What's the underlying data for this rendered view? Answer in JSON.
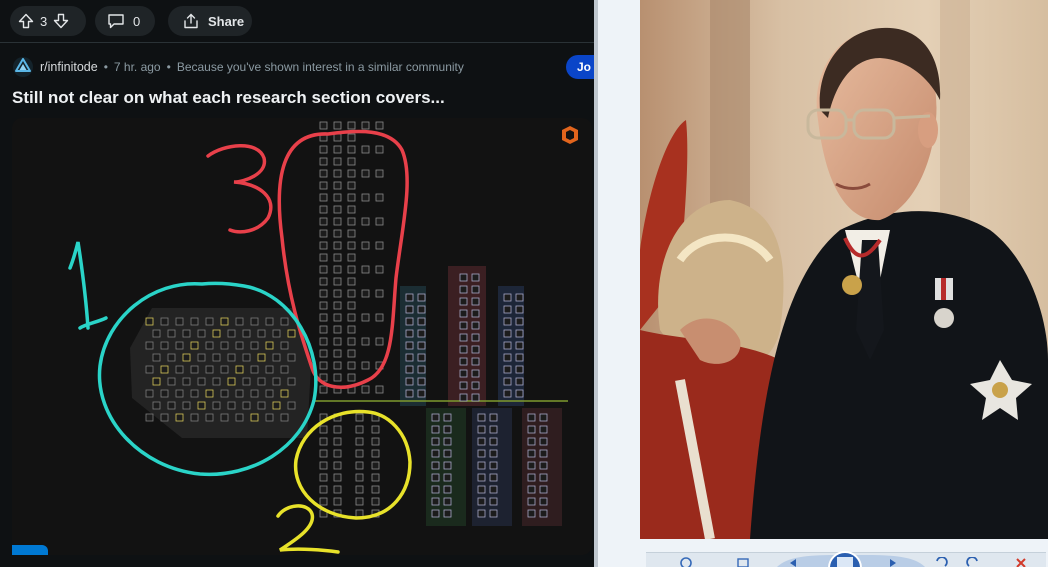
{
  "post": {
    "vote_count": "3",
    "comment_count": "0",
    "share_label": "Share",
    "subreddit": "r/infinitode",
    "time_ago": "7 hr. ago",
    "recommendation_reason": "Because you've shown interest in a similar community",
    "join_label": "Jo",
    "title": "Still not clear on what each research section covers...",
    "annotation_numbers": [
      "1",
      "2",
      "3"
    ]
  },
  "colors": {
    "reddit_bg": "#0e1113",
    "pill_bg": "#1f2427",
    "join_blue": "#0a45c8",
    "annotation_cyan": "#2ad4c8",
    "annotation_red": "#e8404a",
    "annotation_yellow": "#e8e22a",
    "viewer_bg": "#eef3f8"
  },
  "icons": [
    "upvote-icon",
    "downvote-icon",
    "comment-icon",
    "share-icon",
    "community-logo-icon",
    "game-logo-icon"
  ],
  "viewer": {
    "toolbar_icons": [
      "zoom-icon",
      "fit-window-icon",
      "previous-icon",
      "slideshow-icon",
      "next-icon",
      "rotate-left-icon",
      "rotate-right-icon",
      "delete-icon"
    ]
  }
}
